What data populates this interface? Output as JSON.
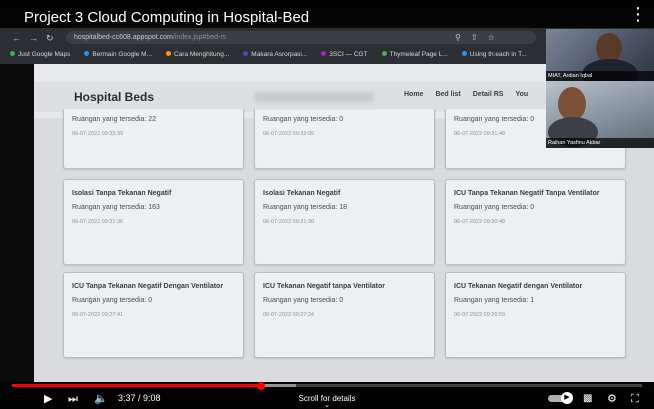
{
  "video": {
    "title": "Project 3 Cloud Computing in Hospital-Bed"
  },
  "browser": {
    "url_host": "hospitalbed-cc608.appspot.com",
    "url_path": "/index.jsp#bed-rs",
    "bookmarks": [
      {
        "label": "Just Google Maps",
        "color": "#4caf50"
      },
      {
        "label": "Bermain Google M...",
        "color": "#2196f3"
      },
      {
        "label": "Cara Menghitung...",
        "color": "#ff9800"
      },
      {
        "label": "Makara Asrorpasi...",
        "color": "#3f51b5"
      },
      {
        "label": "3SCI — CGT",
        "color": "#9c27b0"
      },
      {
        "label": "Thymeleaf Page L...",
        "color": "#4caf50"
      },
      {
        "label": "Using th:each in T...",
        "color": "#2196f3"
      }
    ]
  },
  "app": {
    "brand": "Hospital Beds",
    "nav": [
      "Home",
      "Bed list",
      "Detail RS",
      "You"
    ]
  },
  "cards": [
    {
      "title": "",
      "rooms": "Ruangan yang tersedia: 22",
      "time": "06-07-2022 09:32:39"
    },
    {
      "title": "",
      "rooms": "Ruangan yang tersedia: 0",
      "time": "06-07-2022 09:32:09"
    },
    {
      "title": "",
      "rooms": "Ruangan yang tersedia: 0",
      "time": "06-07-2022 09:31:48"
    },
    {
      "title": "Isolasi Tanpa Tekanan Negatif",
      "rooms": "Ruangan yang tersedia: 163",
      "time": "06-07-2022 09:31:36"
    },
    {
      "title": "Isolasi Tekanan Negatif",
      "rooms": "Ruangan yang tersedia: 18",
      "time": "06-07-2022 09:31:30"
    },
    {
      "title": "ICU Tanpa Tekanan Negatif Tanpa Ventilator",
      "rooms": "Ruangan yang tersedia: 0",
      "time": "06-07-2022 09:30:48"
    },
    {
      "title": "ICU Tanpa Tekanan Negatif Dengan Ventilator",
      "rooms": "Ruangan yang tersedia: 0",
      "time": "06-07-2022 09:27:41"
    },
    {
      "title": "ICU Tekanan Negatif tanpa Ventilator",
      "rooms": "Ruangan yang tersedia: 0",
      "time": "06-07-2022 09:27:24"
    },
    {
      "title": "ICU Tekanan Negatif dengan Ventilator",
      "rooms": "Ruangan yang tersedia: 1",
      "time": "06-07-2022 09:26:59"
    }
  ],
  "webcams": [
    {
      "name": "MIAT, Ardian Iqbal"
    },
    {
      "name": "Raihan Yasfinu Akbar"
    }
  ],
  "player": {
    "current_time": "3:37",
    "duration": "9:08",
    "progress": 0.396,
    "buffered": 0.45,
    "scroll_hint": "Scroll for details",
    "accent_color": "#ff0000"
  }
}
